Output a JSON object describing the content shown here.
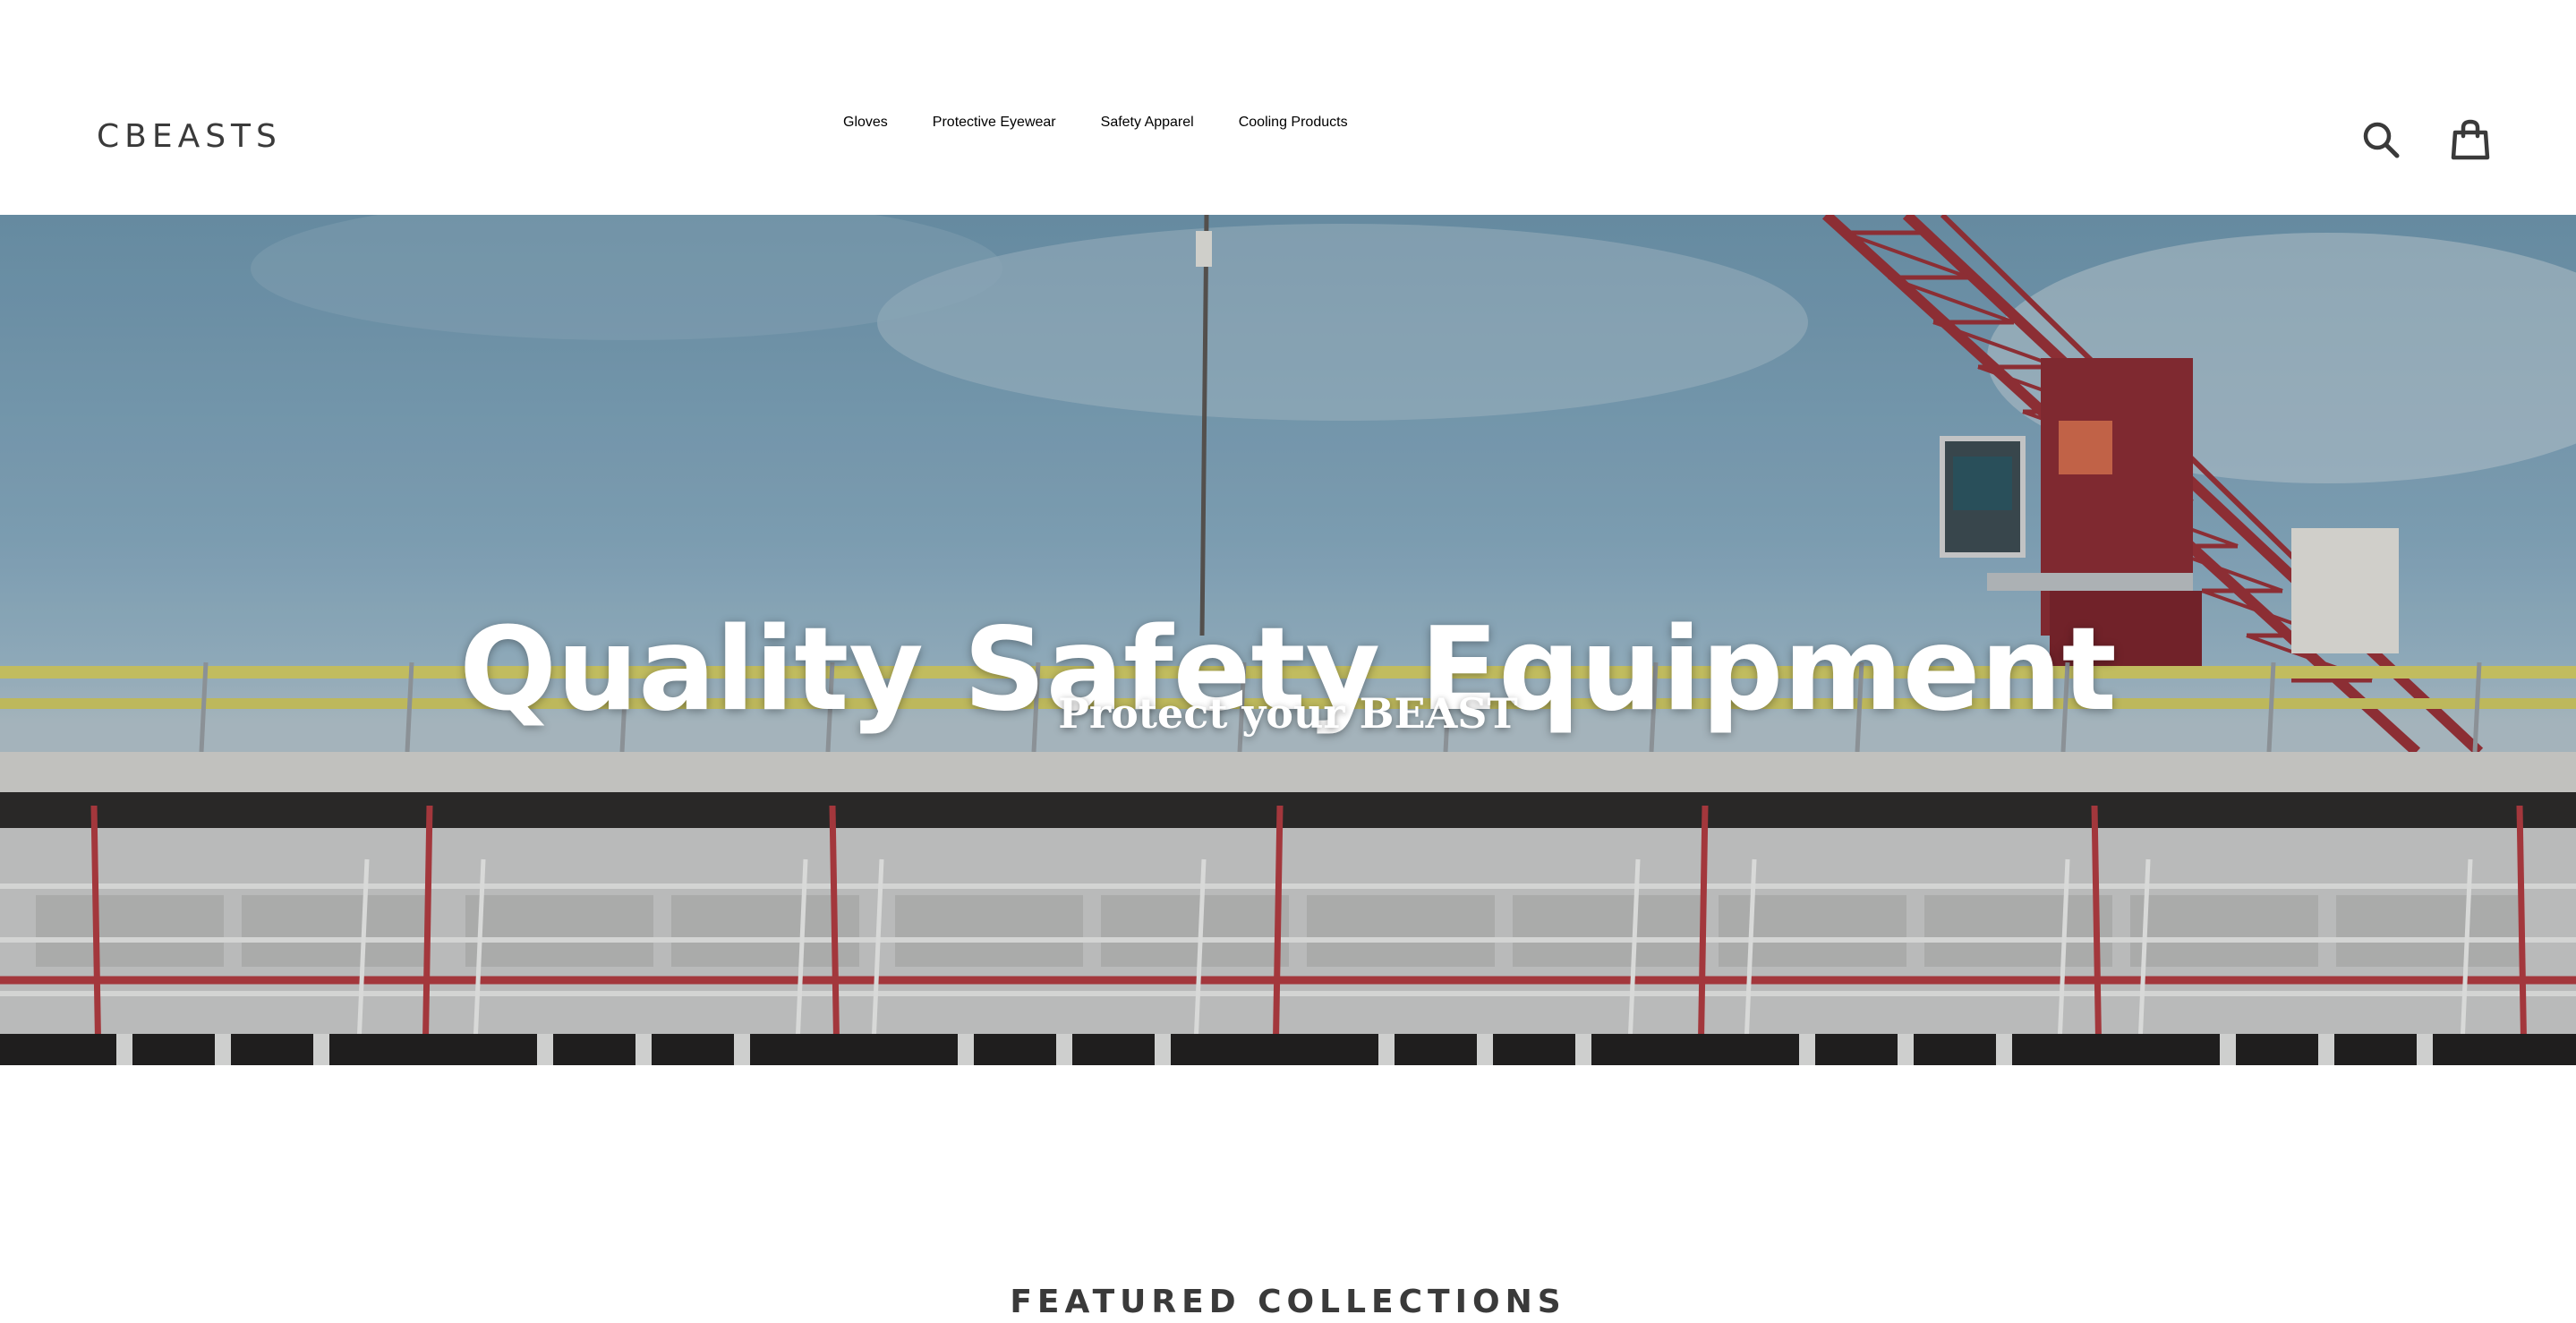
{
  "header": {
    "logo": "CBEASTS",
    "nav": [
      {
        "label": "Gloves"
      },
      {
        "label": "Protective Eyewear"
      },
      {
        "label": "Safety Apparel"
      },
      {
        "label": "Cooling Products"
      }
    ],
    "icons": {
      "search": "search-icon",
      "cart": "shopping-bag-icon"
    }
  },
  "hero": {
    "title": "Quality Safety Equipment",
    "subtitle": "Protect your BEAST"
  },
  "featured": {
    "title": "FEATURED COLLECTIONS"
  },
  "colors": {
    "text": "#3a3a3a",
    "hero_text": "#ffffff",
    "sky": "#7aa2ba",
    "crane_red": "#9b2f35",
    "rail_yellow": "#d8d166"
  }
}
